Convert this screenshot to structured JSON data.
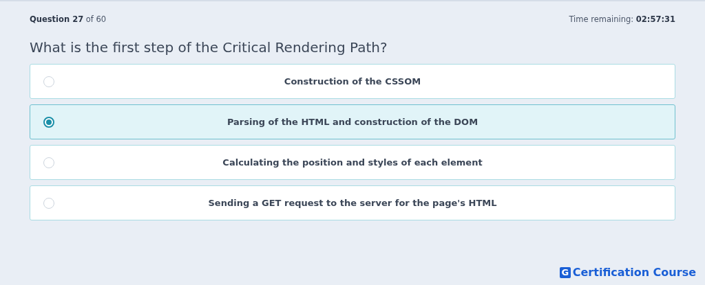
{
  "progress": "**Question 27** of 60",
  "timer": "Time remaining: **02:57:31**",
  "question": "What is the first step of the Critical Rendering Path?",
  "options": [
    {
      "label": "Construction of the CSSOM",
      "selected": false
    },
    {
      "label": "Parsing of the HTML and construction of the DOM",
      "selected": true
    },
    {
      "label": "Calculating the position and styles of each element",
      "selected": false
    },
    {
      "label": "Sending a GET request to the server for the page's HTML",
      "selected": false
    }
  ],
  "logo": {
    "mark": "G",
    "text": "Certification Course"
  }
}
